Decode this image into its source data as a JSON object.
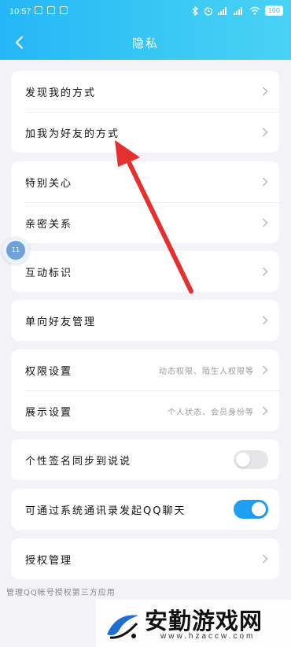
{
  "status": {
    "time": "10:57",
    "battery": "100"
  },
  "header": {
    "title": "隐私"
  },
  "groups": {
    "g1": [
      {
        "label": "发现我的方式"
      },
      {
        "label": "加我为好友的方式"
      }
    ],
    "g2": [
      {
        "label": "特别关心"
      },
      {
        "label": "亲密关系"
      }
    ],
    "g3": [
      {
        "label": "互动标识"
      }
    ],
    "g4": [
      {
        "label": "单向好友管理"
      }
    ],
    "g5": [
      {
        "label": "权限设置",
        "value": "动态权限、陌生人权限等"
      },
      {
        "label": "展示设置",
        "value": "个人状态、会员身份等"
      }
    ],
    "g6": {
      "label": "个性签名同步到说说",
      "on": false
    },
    "g7": {
      "label": "可通过系统通讯录发起QQ聊天",
      "on": true
    },
    "g8": [
      {
        "label": "授权管理"
      }
    ]
  },
  "footnote": "管理QQ帐号授权第三方应用",
  "float_bubble": {
    "text": "11"
  },
  "watermark": {
    "title": "安勤游戏网",
    "url": "www.hzaccw.com"
  },
  "colors": {
    "header_start": "#25b6f7",
    "header_end": "#4ad2f5",
    "toggle_on": "#1e9ff2",
    "arrow": "#e5302f"
  }
}
